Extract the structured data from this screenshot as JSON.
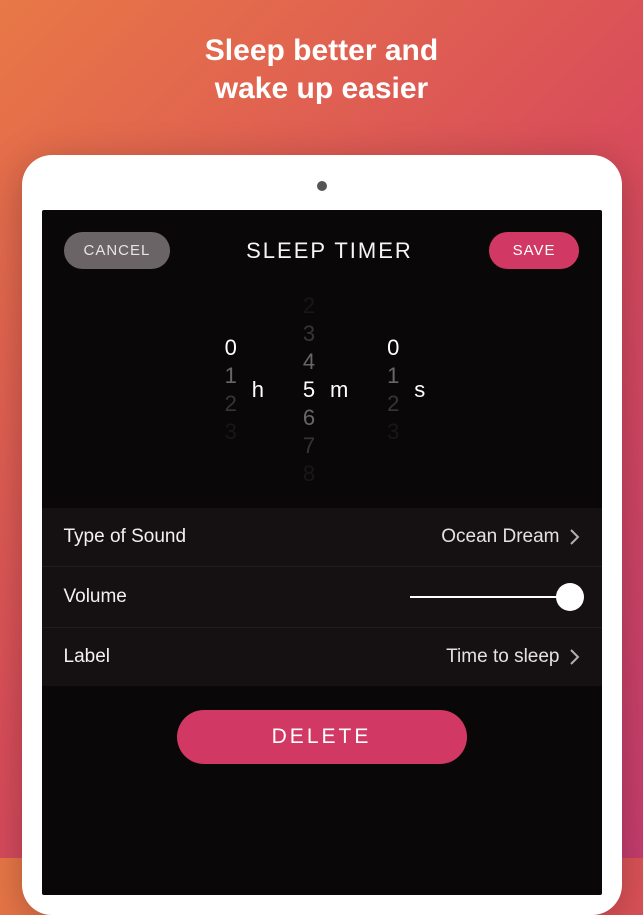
{
  "marketing": {
    "headline_line1": "Sleep better and",
    "headline_line2": "wake up easier"
  },
  "header": {
    "cancel_label": "CANCEL",
    "title": "SLEEP TIMER",
    "save_label": "SAVE"
  },
  "picker": {
    "hours": {
      "prev3": "",
      "prev2": "",
      "prev1": "",
      "current": "0",
      "next1": "1",
      "next2": "2",
      "next3": "3",
      "unit": "h"
    },
    "minutes": {
      "prev3": "2",
      "prev2": "3",
      "prev1": "4",
      "current": "5",
      "next1": "6",
      "next2": "7",
      "next3": "8",
      "unit": "m"
    },
    "seconds": {
      "prev3": "",
      "prev2": "",
      "prev1": "",
      "current": "0",
      "next1": "1",
      "next2": "2",
      "next3": "3",
      "unit": "s"
    }
  },
  "settings": {
    "sound": {
      "label": "Type of Sound",
      "value": "Ocean Dream"
    },
    "volume": {
      "label": "Volume",
      "value": 100
    },
    "label": {
      "label": "Label",
      "value": "Time to sleep"
    }
  },
  "actions": {
    "delete_label": "DELETE"
  }
}
